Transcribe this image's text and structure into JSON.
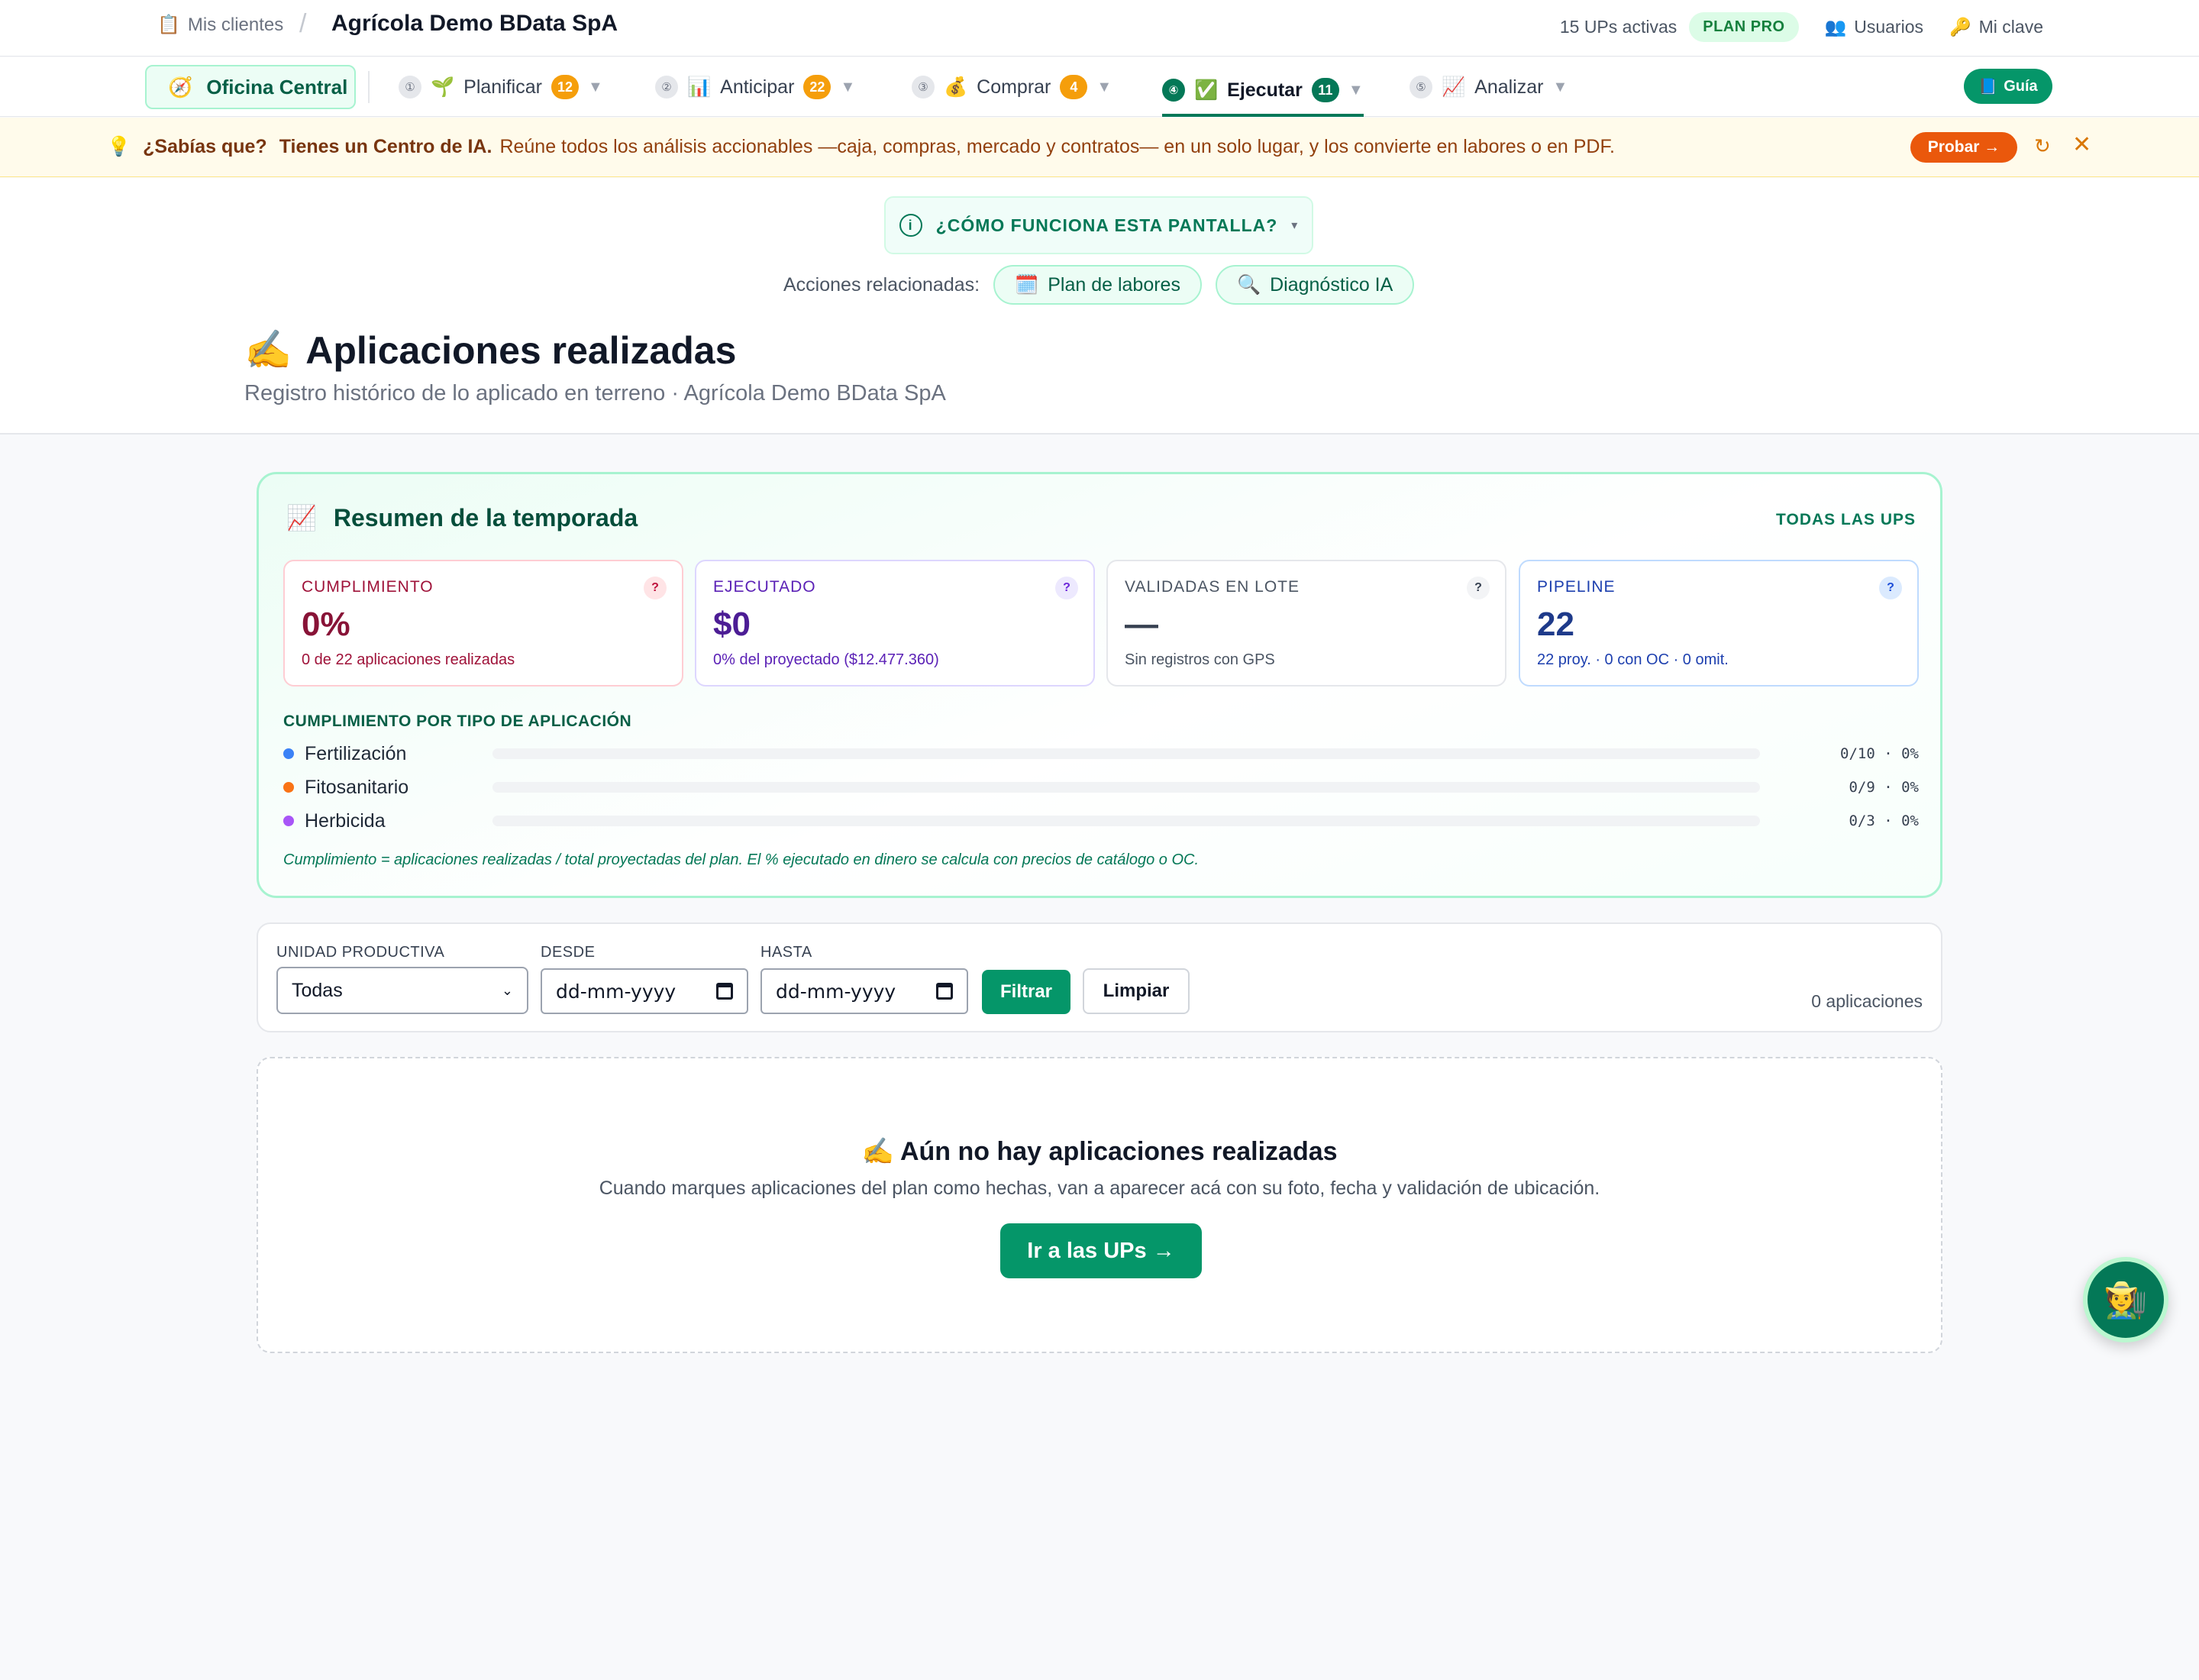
{
  "header": {
    "breadcrumb_root": "Mis clientes",
    "breadcrumb_sep": "/",
    "org_name": "Agrícola Demo BData SpA",
    "active_units": "15 UPs activas",
    "plan_badge": "PLAN PRO",
    "users_label": "Usuarios",
    "key_label": "Mi clave"
  },
  "nav": {
    "home_label": "Oficina Central",
    "items": [
      {
        "step": "①",
        "icon": "🌱",
        "label": "Planificar",
        "count": "12"
      },
      {
        "step": "②",
        "icon": "📊",
        "label": "Anticipar",
        "count": "22"
      },
      {
        "step": "③",
        "icon": "💰",
        "label": "Comprar",
        "count": "4"
      },
      {
        "step": "④",
        "icon": "✅",
        "label": "Ejecutar",
        "count": "11"
      },
      {
        "step": "⑤",
        "icon": "📈",
        "label": "Analizar",
        "count": ""
      }
    ],
    "caret": "▼",
    "guide_label": "Guía"
  },
  "tip": {
    "lead": "¿Sabías que?",
    "headline": "Tienes un Centro de IA.",
    "text": "Reúne todos los análisis accionables —caja, compras, mercado y contratos— en un solo lugar, y los convierte en labores o en PDF.",
    "try_label": "Probar →",
    "refresh": "↻",
    "close": "✕"
  },
  "hero": {
    "how_label": "¿CÓMO FUNCIONA ESTA PANTALLA?",
    "how_caret": "▾",
    "related_label": "Acciones relacionadas:",
    "related": [
      {
        "icon": "🗓️",
        "label": "Plan de labores"
      },
      {
        "icon": "🔍",
        "label": "Diagnóstico IA"
      }
    ],
    "title_icon": "✍️",
    "title": "Aplicaciones realizadas",
    "subtitle": "Registro histórico de lo aplicado en terreno · Agrícola Demo BData SpA"
  },
  "summary": {
    "icon": "📈",
    "title": "Resumen de la temporada",
    "scope": "TODAS LAS UPS",
    "kpis": [
      {
        "label": "CUMPLIMIENTO",
        "value": "0%",
        "note": "0 de 22 aplicaciones realizadas",
        "help": "?"
      },
      {
        "label": "EJECUTADO",
        "value": "$0",
        "note": "0% del proyectado ($12.477.360)",
        "help": "?"
      },
      {
        "label": "VALIDADAS EN LOTE",
        "value": "—",
        "note": "Sin registros con GPS",
        "help": "?"
      },
      {
        "label": "PIPELINE",
        "value": "22",
        "note": "22 proy. · 0 con OC · 0 omit.",
        "help": "?"
      }
    ],
    "by_type_title": "CUMPLIMIENTO POR TIPO DE APLICACIÓN",
    "types": [
      {
        "name": "Fertilización",
        "color": "#3b82f6",
        "done": 0,
        "total": 10,
        "stat": "0/10 · 0%"
      },
      {
        "name": "Fitosanitario",
        "color": "#f97316",
        "done": 0,
        "total": 9,
        "stat": "0/9 · 0%"
      },
      {
        "name": "Herbicida",
        "color": "#a855f7",
        "done": 0,
        "total": 3,
        "stat": "0/3 · 0%"
      }
    ],
    "footnote": "Cumplimiento = aplicaciones realizadas / total proyectadas del plan. El % ejecutado en dinero se calcula con precios de catálogo o OC."
  },
  "filters": {
    "unit_label": "UNIDAD PRODUCTIVA",
    "unit_value": "Todas",
    "from_label": "DESDE",
    "from_placeholder": "dd-mm-yyyy",
    "to_label": "HASTA",
    "to_placeholder": "dd-mm-yyyy",
    "filter_btn": "Filtrar",
    "clear_btn": "Limpiar",
    "count": "0 aplicaciones"
  },
  "empty": {
    "title": "✍️ Aún no hay aplicaciones realizadas",
    "text": "Cuando marques aplicaciones del plan como hechas, van a aparecer acá con su foto, fecha y validación de ubicación.",
    "button": "Ir a las UPs →"
  },
  "fab_icon": "🧑‍🌾"
}
